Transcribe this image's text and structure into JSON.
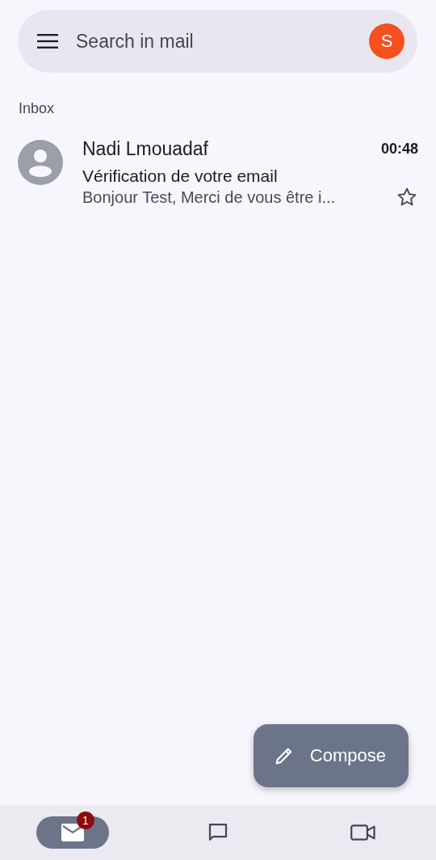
{
  "search": {
    "placeholder": "Search in mail",
    "account_initial": "S"
  },
  "section": "Inbox",
  "emails": [
    {
      "sender": "Nadi Lmouadaf",
      "time": "00:48",
      "subject": "Vérification de votre email",
      "preview": "Bonjour Test, Merci de vous être i...",
      "unread": true,
      "starred": false
    }
  ],
  "compose": {
    "label": "Compose"
  },
  "nav": [
    {
      "kind": "mail",
      "selected": true,
      "badge": "1"
    },
    {
      "kind": "chat",
      "selected": false
    },
    {
      "kind": "meet",
      "selected": false
    }
  ]
}
